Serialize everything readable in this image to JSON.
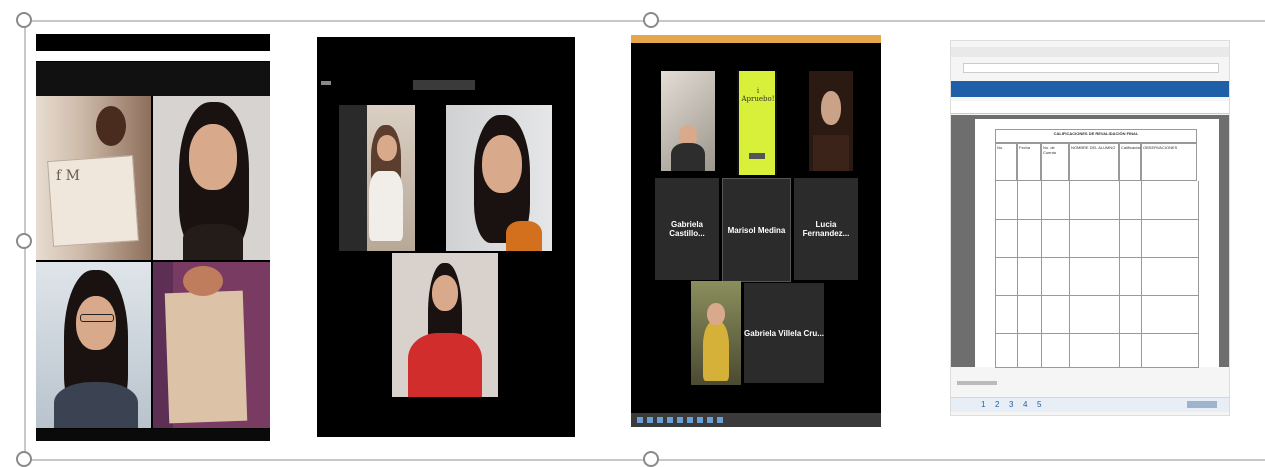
{
  "panel3": {
    "sign_text": "i Apruebo!",
    "tiles": [
      {
        "label": "Gabriela Castillo..."
      },
      {
        "label": "Marisol Medina"
      },
      {
        "label": "Lucia Fernandez..."
      },
      {
        "label": "Gabriela Villela Cru..."
      }
    ]
  },
  "panel4": {
    "doc_title": "CALIFICACIONES DE REVALIDACIÓN FINAL",
    "headers": [
      "No.",
      "Fecha",
      "No. de Cuenta",
      "NOMBRE DEL ALUMNO",
      "Calificación",
      "OBSERVACIONES"
    ],
    "pagination": [
      "1",
      "2",
      "3",
      "4",
      "5"
    ]
  },
  "colors": {
    "accent_blue": "#1f5fa8",
    "sign_yellow": "#d8f03a"
  }
}
